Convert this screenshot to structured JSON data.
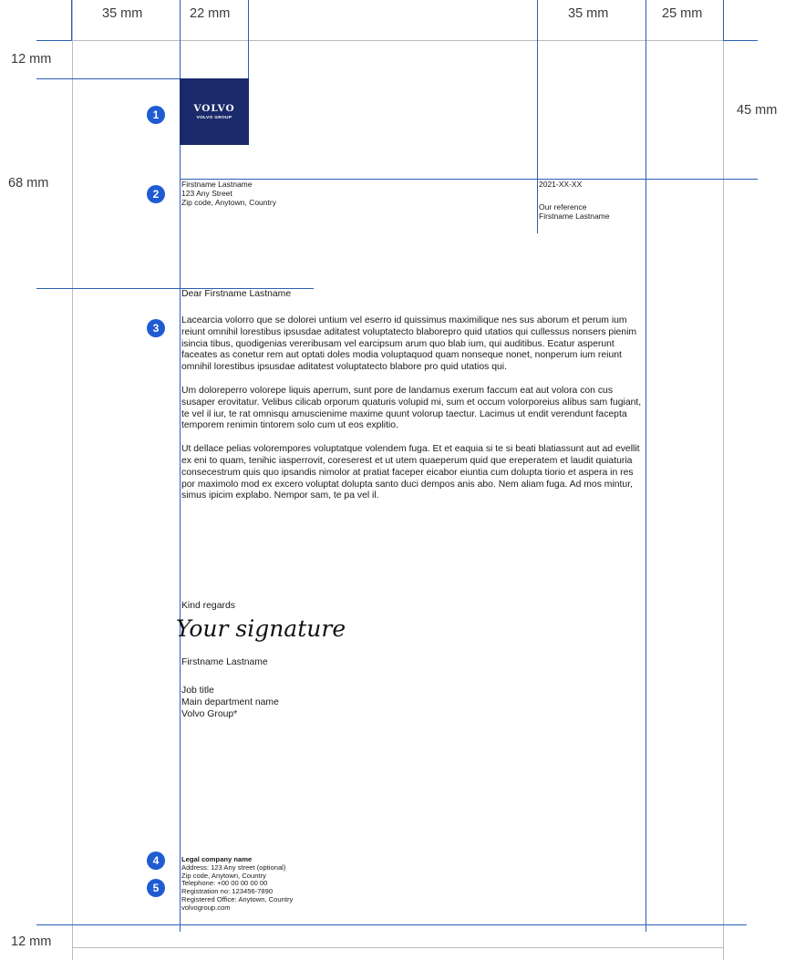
{
  "measurements": {
    "top_left_margin": "35 mm",
    "top_text_column": "22 mm",
    "top_reference_column": "35 mm",
    "top_right_margin": "25 mm",
    "left_top_margin": "12 mm",
    "left_address_offset": "68 mm",
    "left_bottom_margin": "12 mm",
    "right_header_offset": "45 mm"
  },
  "markers": [
    "1",
    "2",
    "3",
    "4",
    "5"
  ],
  "logo": {
    "wordmark": "VOLVO",
    "subline": "VOLVO GROUP",
    "background": "#1b2a6b"
  },
  "recipient": {
    "name": "Firstname Lastname",
    "street": "123 Any Street",
    "city": "Zip code, Anytown, Country"
  },
  "reference": {
    "date": "2021-XX-XX",
    "label": "Our reference",
    "name": "Firstname Lastname"
  },
  "letter": {
    "salutation": "Dear Firstname Lastname",
    "paragraphs": [
      "Lacearcia volorro que se dolorei untium vel eserro id quissimus maximilique nes sus aborum et perum ium reiunt omnihil lorestibus ipsusdae aditatest voluptatecto blaborepro quid utatios qui cullessus nonsers pienim isincia tibus, quodigenias vereribusam vel earcipsum arum quo blab ium, qui auditibus. Ecatur asperunt faceates as conetur rem aut optati doles modia voluptaquod quam nonseque nonet, nonperum ium reiunt omnihil lorestibus ipsusdae aditatest voluptatecto blabore pro quid utatios qui.",
      "Um doloreperro volorepe liquis aperrum, sunt pore de landamus exerum faccum eat aut volora con cus susaper erovitatur. Velibus cilicab orporum quaturis volupid mi, sum et occum volorporeius alibus sam fugiant, te vel il iur, te rat omnisqu amuscienime maxime quunt volorup taectur. Lacimus ut endit verendunt facepta temporem renimin tintorem solo cum ut eos explitio.",
      "Ut dellace pelias volorempores voluptatque volendem fuga. Et et eaquia si te si beati blatiassunt aut ad evellit ex eni to quam, tenihic iasperrovit, coreserest et ut utem quaeperum quid que ereperatem et laudit quiaturia consecestrum quis quo ipsandis nimolor at pratiat faceper eicabor eiuntia cum dolupta tiorio et aspera in res por maximolo mod ex excero voluptat dolupta santo duci dempos anis abo. Nem aliam fuga. Ad mos mintur, simus ipicim explabo. Nempor sam, te pa vel il."
    ],
    "closing": "Kind regards",
    "signature": "Your signature",
    "sender_name": "Firstname Lastname",
    "job_title": "Job title",
    "department": "Main department name",
    "company": "Volvo Group*"
  },
  "footer": {
    "company_name": "Legal company name",
    "address": "Address: 123 Any street (optional)",
    "city": "Zip code, Anytown, Country",
    "telephone": "Telephone: +00 00 00 00 00",
    "registration": "Registration no: 123456-7890",
    "office": "Registered Office: Anytown, Country",
    "website": "volvogroup.com"
  },
  "colors": {
    "guide_line": "#2b5fb4",
    "margin_line": "#b8bcc4",
    "marker": "#1f5bd3"
  }
}
